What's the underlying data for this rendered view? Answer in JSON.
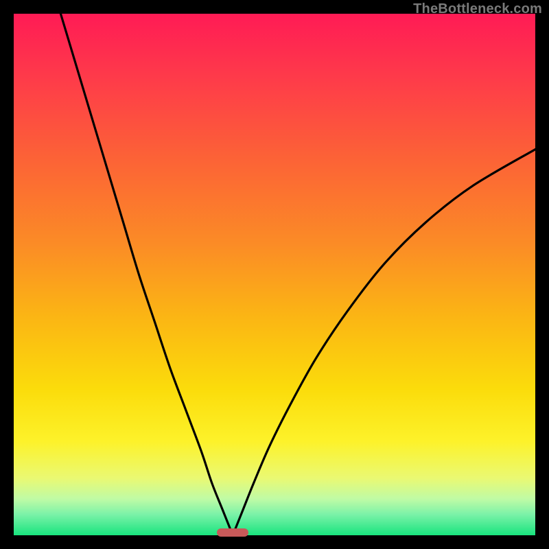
{
  "watermark": "TheBottleneck.com",
  "colors": {
    "frame": "#000000",
    "curve": "#000000",
    "marker": "#c75959",
    "gradient_top": "#ff1b55",
    "gradient_bottom": "#18e47e"
  },
  "chart_data": {
    "type": "line",
    "title": "",
    "xlabel": "",
    "ylabel": "",
    "xlim": [
      0,
      100
    ],
    "ylim": [
      0,
      100
    ],
    "note": "Axes are unlabeled; values are read as percentages of the plot area. Two black curves descend toward a minimum at x≈42 where a short red pill marks the bottom; the left curve rises to the top-left corner, the right curve rises toward the upper-right third.",
    "marker_x": 42,
    "marker_width": 6,
    "series": [
      {
        "name": "left-curve",
        "x": [
          9,
          12,
          15,
          18,
          21,
          24,
          27,
          30,
          33,
          36,
          38,
          40,
          42
        ],
        "y": [
          100,
          90,
          80,
          70,
          60,
          50,
          41,
          32,
          24,
          16,
          10,
          5,
          0
        ]
      },
      {
        "name": "right-curve",
        "x": [
          42,
          44,
          46,
          49,
          53,
          58,
          64,
          71,
          79,
          88,
          100
        ],
        "y": [
          0,
          5,
          10,
          17,
          25,
          34,
          43,
          52,
          60,
          67,
          74
        ]
      }
    ]
  }
}
